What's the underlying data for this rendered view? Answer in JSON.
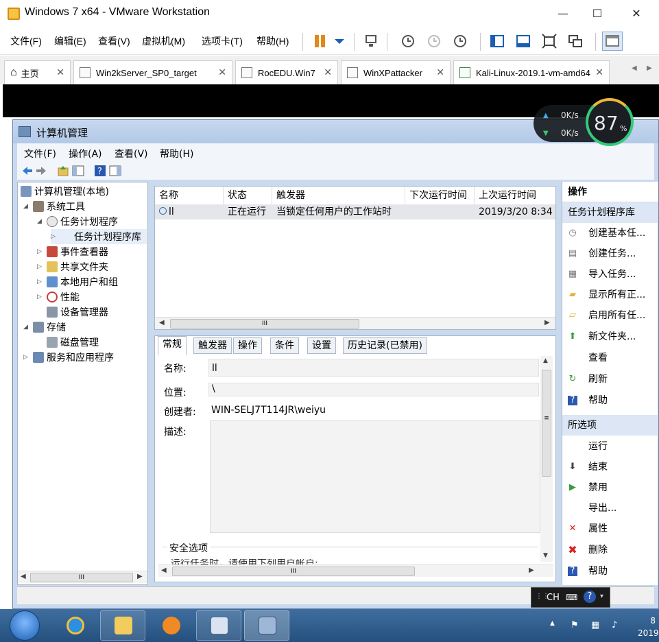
{
  "vm": {
    "title": "Windows 7 x64 - VMware Workstation",
    "window_controls": {
      "minimize": "—",
      "maximize": "☐",
      "close": "✕"
    },
    "menu": [
      "文件(F)",
      "编辑(E)",
      "查看(V)",
      "虚拟机(M)",
      "选项卡(T)",
      "帮助(H)"
    ],
    "tabs": [
      {
        "label": "主页"
      },
      {
        "label": "Win2kServer_SP0_target"
      },
      {
        "label": "RocEDU.Win7"
      },
      {
        "label": "WinXPattacker"
      },
      {
        "label": "Kali-Linux-2019.1-vm-amd64"
      }
    ],
    "tab_close": "✕",
    "tab_nav": {
      "prev": "◀",
      "next": "▶"
    }
  },
  "cm": {
    "title": "计算机管理",
    "menu": [
      "文件(F)",
      "操作(A)",
      "查看(V)",
      "帮助(H)"
    ],
    "tree": [
      {
        "label": "计算机管理(本地)",
        "level": 0,
        "arrow": ""
      },
      {
        "label": "系统工具",
        "level": 1,
        "arrow": "◢"
      },
      {
        "label": "任务计划程序",
        "level": 2,
        "arrow": "◢"
      },
      {
        "label": "任务计划程序库",
        "level": 3,
        "arrow": "▷"
      },
      {
        "label": "事件查看器",
        "level": 2,
        "arrow": "▷"
      },
      {
        "label": "共享文件夹",
        "level": 2,
        "arrow": "▷"
      },
      {
        "label": "本地用户和组",
        "level": 2,
        "arrow": "▷"
      },
      {
        "label": "性能",
        "level": 2,
        "arrow": "▷"
      },
      {
        "label": "设备管理器",
        "level": 2,
        "arrow": ""
      },
      {
        "label": "存储",
        "level": 1,
        "arrow": "◢"
      },
      {
        "label": "磁盘管理",
        "level": 2,
        "arrow": ""
      },
      {
        "label": "服务和应用程序",
        "level": 1,
        "arrow": "▷"
      }
    ],
    "task_columns": [
      "名称",
      "状态",
      "触发器",
      "下次运行时间",
      "上次运行时间"
    ],
    "task_row": {
      "name": "ll",
      "status": "正在运行",
      "trigger": "当锁定任何用户的工作站时",
      "next": "",
      "last": "2019/3/20 8:34"
    },
    "detail_tabs": [
      "常规",
      "触发器",
      "操作",
      "条件",
      "设置",
      "历史记录(已禁用)"
    ],
    "fields": {
      "name_label": "名称:",
      "name_value": "ll",
      "location_label": "位置:",
      "location_value": "\\",
      "author_label": "创建者:",
      "author_value": "WIN-SELJ7T114JR\\weiyu",
      "desc_label": "描述:"
    },
    "security_label": "安全选项",
    "security_text": "运行任务时，请使用下列用户帐户:",
    "actions": {
      "header": "操作",
      "section1": "任务计划程序库",
      "items1": [
        {
          "label": "创建基本任...",
          "icon": "◷"
        },
        {
          "label": "创建任务...",
          "icon": "▤"
        },
        {
          "label": "导入任务...",
          "icon": "▦"
        },
        {
          "label": "显示所有正...",
          "icon": "▰"
        },
        {
          "label": "启用所有任...",
          "icon": "▱"
        },
        {
          "label": "新文件夹...",
          "icon": "⬆"
        },
        {
          "label": "查看",
          "icon": ""
        },
        {
          "label": "刷新",
          "icon": "↻"
        },
        {
          "label": "帮助",
          "icon": "?"
        }
      ],
      "section2": "所选项",
      "items2": [
        {
          "label": "运行",
          "icon": ""
        },
        {
          "label": "结束",
          "icon": "⬇"
        },
        {
          "label": "禁用",
          "icon": "▶"
        },
        {
          "label": "导出...",
          "icon": ""
        },
        {
          "label": "属性",
          "icon": "✕"
        },
        {
          "label": "删除",
          "icon": "✖"
        },
        {
          "label": "帮助",
          "icon": "?"
        }
      ]
    },
    "scroll": {
      "left": "◀",
      "right": "▶",
      "up": "▲",
      "down": "▼",
      "grip": "III"
    }
  },
  "net": {
    "up_speed": "0K/s",
    "down_speed": "0K/s",
    "percent": "87",
    "percent_sign": "%"
  },
  "ime": {
    "lang": "CH"
  },
  "tray": {
    "time_line1": "8",
    "time_line2": "2019"
  },
  "colors": {
    "accent": "#0078d7",
    "taskbar": "#2c5a8a",
    "selected_row": "#e4e6ea"
  }
}
